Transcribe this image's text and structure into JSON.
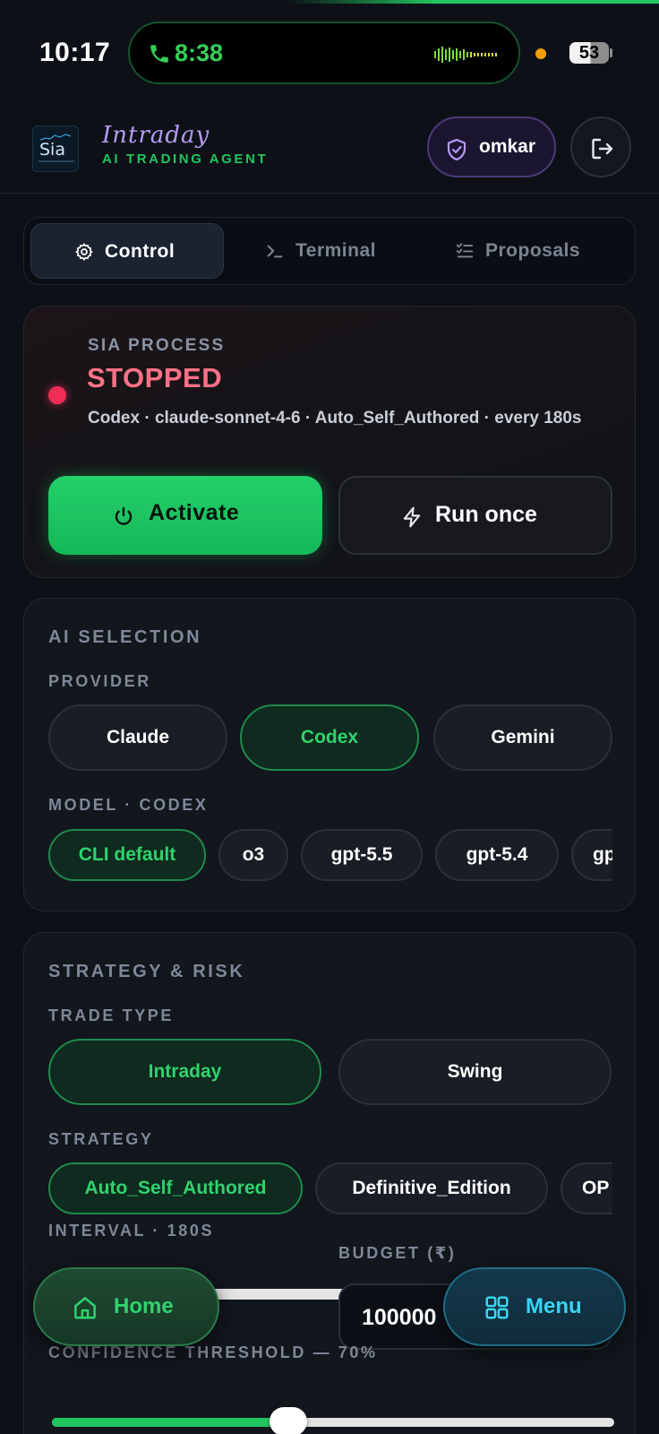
{
  "status_bar": {
    "time": "10:17",
    "call_timer": "8:38",
    "battery": "53",
    "icons": [
      "phone-icon",
      "audio-wave-icon",
      "battery-icon"
    ]
  },
  "header": {
    "logo_text": "Sia",
    "brand_title": "Intraday",
    "brand_subtitle": "AI TRADING AGENT",
    "user_name": "omkar",
    "icons": [
      "shield-icon",
      "logout-icon"
    ]
  },
  "tabs": [
    {
      "label": "Control",
      "icon": "gear-icon",
      "active": true
    },
    {
      "label": "Terminal",
      "icon": "terminal-icon",
      "active": false
    },
    {
      "label": "Proposals",
      "icon": "checklist-icon",
      "active": false
    }
  ],
  "process": {
    "label": "SIA PROCESS",
    "status": "STOPPED",
    "details": "Codex · claude-sonnet-4-6 · Auto_Self_Authored · every 180s",
    "activate_label": "Activate",
    "run_once_label": "Run once"
  },
  "ai_selection": {
    "title": "AI SELECTION",
    "provider_label": "PROVIDER",
    "providers": [
      {
        "label": "Claude",
        "active": false
      },
      {
        "label": "Codex",
        "active": true
      },
      {
        "label": "Gemini",
        "active": false
      }
    ],
    "model_label": "MODEL · CODEX",
    "models": [
      {
        "label": "CLI default",
        "active": true
      },
      {
        "label": "o3",
        "active": false
      },
      {
        "label": "gpt-5.5",
        "active": false
      },
      {
        "label": "gpt-5.4",
        "active": false
      },
      {
        "label": "gpt",
        "active": false
      }
    ]
  },
  "strategy_risk": {
    "title": "STRATEGY & RISK",
    "trade_type_label": "TRADE TYPE",
    "trade_types": [
      {
        "label": "Intraday",
        "active": true
      },
      {
        "label": "Swing",
        "active": false
      }
    ],
    "strategy_label": "STRATEGY",
    "strategies": [
      {
        "label": "Auto_Self_Authored",
        "active": true
      },
      {
        "label": "Definitive_Edition",
        "active": false
      },
      {
        "label": "OP",
        "active": false
      }
    ],
    "interval_label": "INTERVAL · 180S",
    "budget_label": "BUDGET (₹)",
    "budget_value": "100000",
    "confidence_label": "CONFIDENCE THRESHOLD — 70%",
    "confidence_fraction": 0.42
  },
  "floating_nav": {
    "home_label": "Home",
    "menu_label": "Menu"
  },
  "colors": {
    "accent_green": "#22c55e",
    "stopped_red": "#fb7185",
    "menu_cyan": "#38d4f5",
    "brand_purple": "#b69cf5"
  }
}
